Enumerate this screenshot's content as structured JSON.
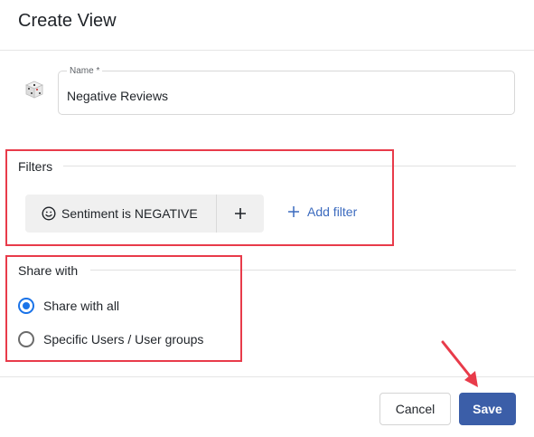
{
  "dialog": {
    "title": "Create View"
  },
  "name_field": {
    "label": "Name *",
    "value": "Negative Reviews",
    "icon": "dice-icon"
  },
  "filters": {
    "heading": "Filters",
    "items": [
      {
        "label": "Sentiment is NEGATIVE",
        "icon": "smiley-icon"
      }
    ],
    "add_filter_label": "Add filter"
  },
  "share": {
    "heading": "Share with",
    "options": [
      {
        "label": "Share with all",
        "selected": true
      },
      {
        "label": "Specific Users / User groups",
        "selected": false
      }
    ]
  },
  "footer": {
    "cancel_label": "Cancel",
    "save_label": "Save"
  },
  "colors": {
    "accent": "#1a73e8",
    "primary_button": "#3b5ea8",
    "link": "#3c6bbf",
    "annotation": "#e83b4a"
  }
}
